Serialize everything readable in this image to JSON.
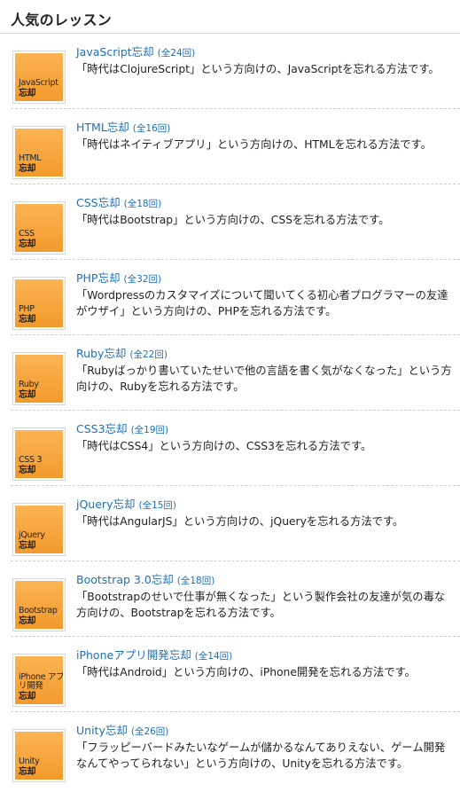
{
  "header": {
    "title": "人気のレッスン"
  },
  "thumb_suffix": "忘却",
  "lessons": [
    {
      "thumb_label": "JavaScript",
      "title": "JavaScript忘却",
      "count": "(全24回)",
      "desc": "「時代はClojureScript」という方向けの、JavaScriptを忘れる方法です。"
    },
    {
      "thumb_label": "HTML",
      "title": "HTML忘却",
      "count": "(全16回)",
      "desc": "「時代はネイティブアプリ」という方向けの、HTMLを忘れる方法です。"
    },
    {
      "thumb_label": "CSS",
      "title": "CSS忘却",
      "count": "(全18回)",
      "desc": "「時代はBootstrap」という方向けの、CSSを忘れる方法です。"
    },
    {
      "thumb_label": "PHP",
      "title": "PHP忘却",
      "count": "(全32回)",
      "desc": "「Wordpressのカスタマイズについて聞いてくる初心者プログラマーの友達がウザイ」という方向けの、PHPを忘れる方法です。"
    },
    {
      "thumb_label": "Ruby",
      "title": "Ruby忘却",
      "count": "(全22回)",
      "desc": "「Rubyばっかり書いていたせいで他の言語を書く気がなくなった」という方向けの、Rubyを忘れる方法です。"
    },
    {
      "thumb_label": "CSS 3",
      "title": "CSS3忘却",
      "count": "(全19回)",
      "desc": "「時代はCSS4」という方向けの、CSS3を忘れる方法です。"
    },
    {
      "thumb_label": "jQuery",
      "title": "jQuery忘却",
      "count": "(全15回)",
      "desc": "「時代はAngularJS」という方向けの、jQueryを忘れる方法です。"
    },
    {
      "thumb_label": "Bootstrap",
      "title": "Bootstrap 3.0忘却",
      "count": "(全18回)",
      "desc": "「Bootstrapのせいで仕事が無くなった」という製作会社の友達が気の毒な方向けの、Bootstrapを忘れる方法です。"
    },
    {
      "thumb_label": "iPhone アプリ開発",
      "title": "iPhoneアプリ開発忘却",
      "count": "(全14回)",
      "desc": "「時代はAndroid」という方向けの、iPhone開発を忘れる方法です。"
    },
    {
      "thumb_label": "Unity",
      "title": "Unity忘却",
      "count": "(全26回)",
      "desc": "「フラッピーバードみたいなゲームが儲かるなんてありえない、ゲーム開発なんてやってられない」という方向けの、Unityを忘れる方法です。"
    }
  ]
}
